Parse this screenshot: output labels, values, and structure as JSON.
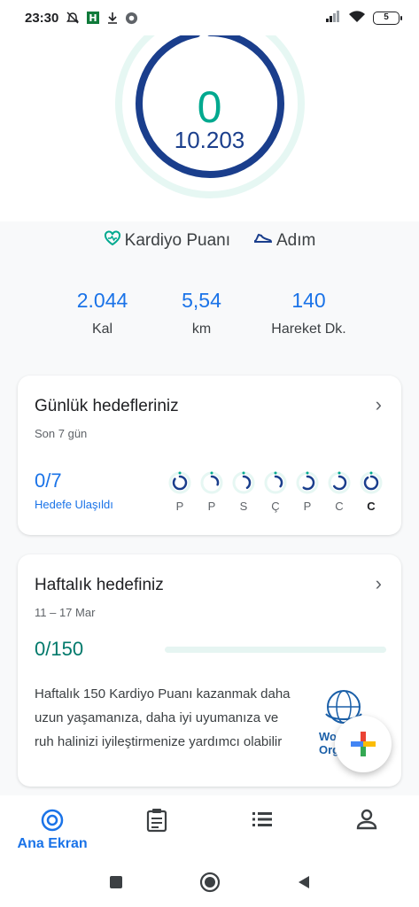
{
  "status_bar": {
    "time": "23:30",
    "battery": "5",
    "icons": [
      "alarm-off-icon",
      "app-notification-icon",
      "download-icon",
      "chrome-icon",
      "signal-icon",
      "wifi-icon",
      "battery-icon"
    ]
  },
  "ring": {
    "cardio_points": "0",
    "steps": "10.203",
    "cardio_progress": 0.0,
    "steps_progress": 0.97,
    "colors": {
      "cardio": "#00a98f",
      "steps": "#1a3e8c",
      "cardio_track": "#e6f7f3"
    }
  },
  "legend": {
    "cardio_label": "Kardiyo Puanı",
    "steps_label": "Adım"
  },
  "stats": [
    {
      "value": "2.044",
      "label": "Kal"
    },
    {
      "value": "5,54",
      "label": "km"
    },
    {
      "value": "140",
      "label": "Hareket Dk."
    }
  ],
  "daily_goals": {
    "title": "Günlük hedefleriniz",
    "subtitle": "Son 7 gün",
    "count": "0/7",
    "count_label": "Hedefe Ulaşıldı",
    "days": [
      {
        "letter": "P",
        "progress": 0.85
      },
      {
        "letter": "P",
        "progress": 0.3
      },
      {
        "letter": "S",
        "progress": 0.4
      },
      {
        "letter": "Ç",
        "progress": 0.35
      },
      {
        "letter": "P",
        "progress": 0.6
      },
      {
        "letter": "C",
        "progress": 0.65
      },
      {
        "letter": "C",
        "progress": 0.9,
        "today": true
      }
    ]
  },
  "weekly_goal": {
    "title": "Haftalık hedefiniz",
    "date_range": "11 – 17 Mar",
    "count": "0/150",
    "progress": 0.0,
    "description": "Haftalık 150 Kardiyo Puanı kazanmak daha uzun yaşamanıza, daha iyi uyumanıza ve ruh halinizi iyileştirmenize yardımcı olabilir",
    "who_text_line1": "Wo",
    "who_text_line2": "Org"
  },
  "bottom_nav": {
    "items": [
      {
        "label": "Ana Ekran",
        "icon": "home-ring-icon",
        "active": true
      },
      {
        "label": "",
        "icon": "journal-icon"
      },
      {
        "label": "",
        "icon": "browse-list-icon"
      },
      {
        "label": "",
        "icon": "profile-icon"
      }
    ]
  },
  "system_nav": [
    "recents-button",
    "home-button",
    "back-button"
  ]
}
